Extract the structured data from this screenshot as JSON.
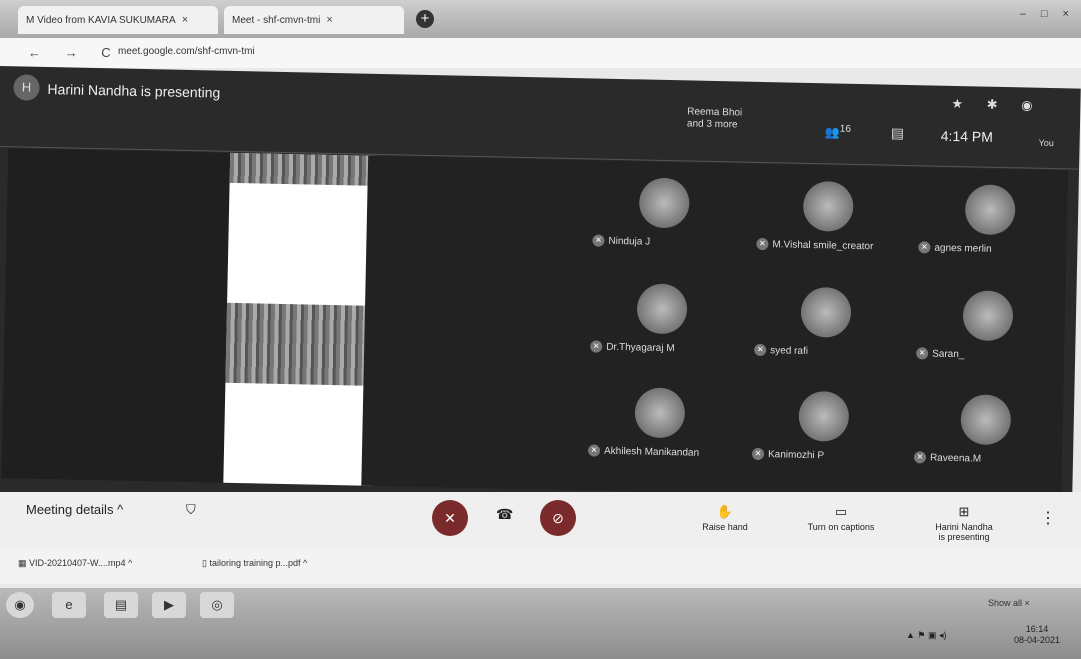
{
  "browser": {
    "tabs": [
      {
        "label": "M  Video from KAVIA SUKUMARA",
        "close": "×"
      },
      {
        "label": "Meet - shf-cmvn-tmi",
        "close": "×"
      }
    ],
    "new_tab": "+",
    "nav": "← → C",
    "url": "meet.google.com/shf-cmvn-tmi",
    "window_controls": "– □ ×"
  },
  "meet": {
    "presenting_title": "Harini Nandha is presenting",
    "presenter_avatar_letter": "H",
    "presentation_by": [
      "Reema Bhoi",
      "and 3 more"
    ],
    "people_count": "16",
    "clock": "4:14 PM",
    "you_label": "You",
    "participants": [
      {
        "name": "Ninduja J"
      },
      {
        "name": "M.Vishal smile_creator"
      },
      {
        "name": "agnes merlin"
      },
      {
        "name": "Dr.Thyagaraj M"
      },
      {
        "name": "syed rafi"
      },
      {
        "name": "Saran_"
      },
      {
        "name": "Akhilesh Manikandan"
      },
      {
        "name": "Kanimozhi P"
      },
      {
        "name": "Raveena.M"
      }
    ]
  },
  "controls": {
    "meeting_details": "Meeting details",
    "raise_hand": "Raise hand",
    "captions": "Turn on captions",
    "presenting": [
      "Harini Nandha",
      "is presenting"
    ]
  },
  "downloads": {
    "items": [
      "VID-20210407-W....mp4",
      "tailoring training p...pdf"
    ],
    "show_all": "Show all"
  },
  "taskbar": {
    "time": "16:14",
    "date": "08-04-2021"
  },
  "colors": {
    "meet_bg": "#2a2a2a",
    "end_call": "#7a2a2a"
  }
}
